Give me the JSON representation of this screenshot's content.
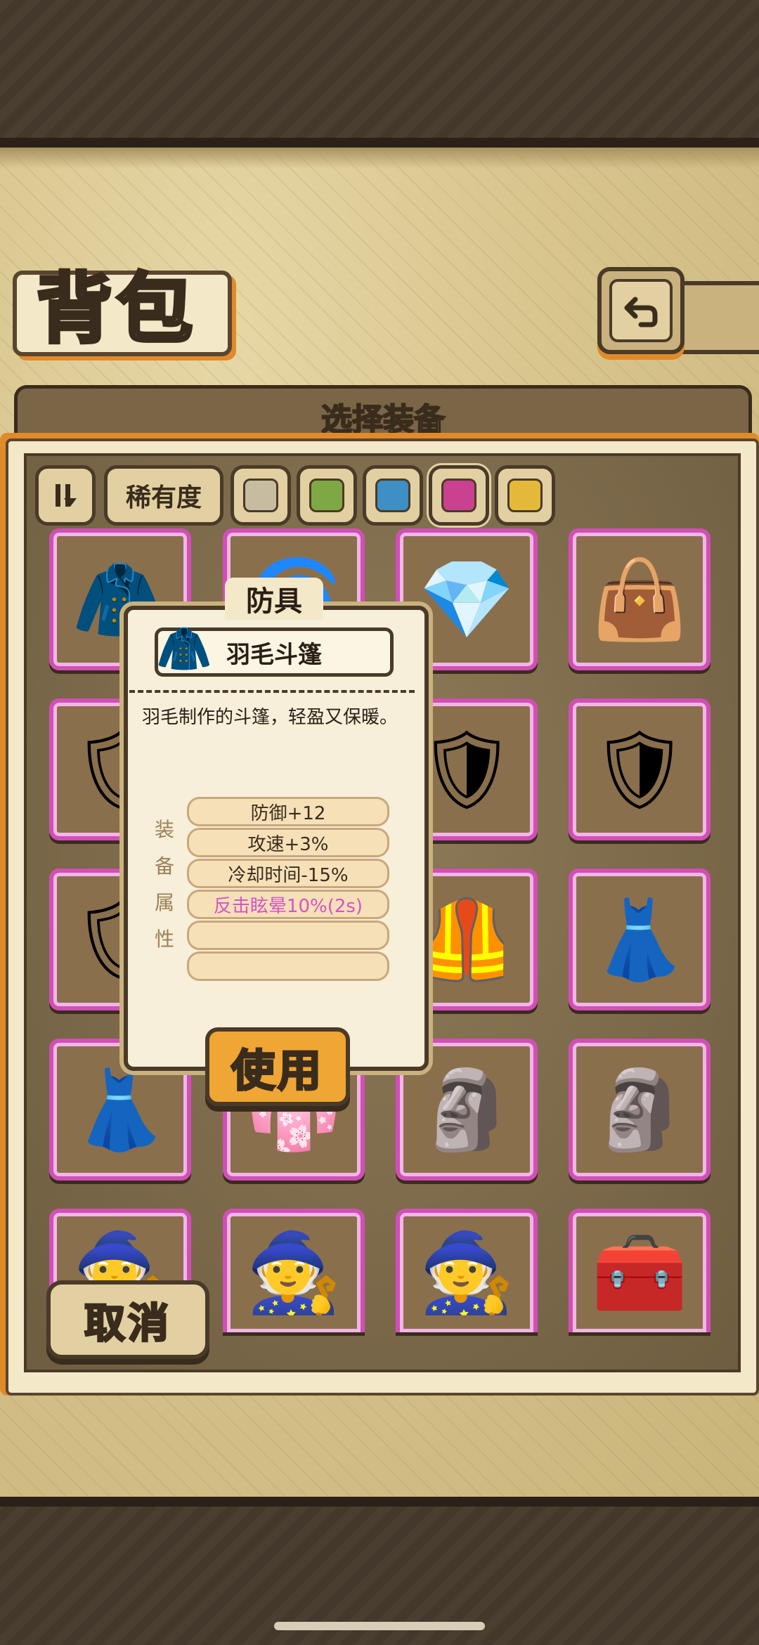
{
  "header": {
    "title": "背包",
    "back_icon": "return-arrow-icon"
  },
  "panel": {
    "title": "选择装备"
  },
  "filters": {
    "sort_icon": "sort-toggle-icon",
    "rarity_label": "稀有度",
    "swatches": [
      {
        "name": "gray",
        "color": "#c7bba0"
      },
      {
        "name": "green",
        "color": "#7ea844"
      },
      {
        "name": "blue",
        "color": "#3d8fc4"
      },
      {
        "name": "purple",
        "color": "#c9418f"
      },
      {
        "name": "gold",
        "color": "#e4b93a"
      }
    ]
  },
  "grid": {
    "border_color": "#d14fb6",
    "items": [
      {
        "icon": "feather-cloak-icon",
        "glyph": "🧥"
      },
      {
        "icon": "coiled-rope-icon",
        "glyph": "🌀"
      },
      {
        "icon": "crystal-gauntlets-icon",
        "glyph": "💎"
      },
      {
        "icon": "tote-bag-icon",
        "glyph": "👜"
      },
      {
        "icon": "pink-shield-icon",
        "glyph": "🛡"
      },
      {
        "icon": "pink-shield-icon",
        "glyph": "🛡"
      },
      {
        "icon": "pink-shield-icon",
        "glyph": "🛡"
      },
      {
        "icon": "pink-shield-icon",
        "glyph": "🛡"
      },
      {
        "icon": "pink-shield-icon",
        "glyph": "🛡"
      },
      {
        "icon": "hidden-item-icon",
        "glyph": ""
      },
      {
        "icon": "dark-armor-icon",
        "glyph": "🦺"
      },
      {
        "icon": "maid-outfit-icon",
        "glyph": "👗"
      },
      {
        "icon": "maid-outfit-icon",
        "glyph": "👗"
      },
      {
        "icon": "frilly-dress-icon",
        "glyph": "👘"
      },
      {
        "icon": "pharaoh-mask-icon",
        "glyph": "🗿"
      },
      {
        "icon": "pharaoh-mask-icon",
        "glyph": "🗿"
      },
      {
        "icon": "dark-robe-icon",
        "glyph": "🧙"
      },
      {
        "icon": "dark-robe-icon",
        "glyph": "🧙"
      },
      {
        "icon": "dark-robe-icon",
        "glyph": "🧙"
      },
      {
        "icon": "first-aid-box-icon",
        "glyph": "🧰"
      }
    ]
  },
  "tooltip": {
    "category": "防具",
    "item_name": "羽毛斗篷",
    "item_icon": "feather-cloak-icon",
    "description": "羽毛制作的斗篷，轻盈又保暖。",
    "attr_title": [
      "装",
      "备",
      "属",
      "性"
    ],
    "attributes": [
      "防御+12",
      "攻速+3%",
      "冷却时间-15%",
      "反击眩晕10%(2s)",
      "",
      ""
    ],
    "special_color": "#d455c5",
    "use_label": "使用"
  },
  "footer": {
    "cancel_label": "取消"
  }
}
